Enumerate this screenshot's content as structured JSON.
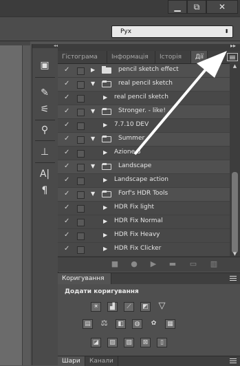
{
  "window": {
    "minimize": "▁",
    "restore": "⧉",
    "close": "✕"
  },
  "workspace": {
    "selected": "Рух"
  },
  "tabs": [
    {
      "label": "Гістограма"
    },
    {
      "label": "Інформація"
    },
    {
      "label": "Історія"
    },
    {
      "label": "Дії"
    }
  ],
  "actions": [
    {
      "label": "pencil sketch effect",
      "type": "set",
      "expanded": false
    },
    {
      "label": "real pencil sketch",
      "type": "set",
      "expanded": true
    },
    {
      "label": "real pencil sketch",
      "type": "action"
    },
    {
      "label": "Stronger. - like!",
      "type": "set",
      "expanded": true
    },
    {
      "label": "7.7.10 DEV",
      "type": "action"
    },
    {
      "label": "Summer",
      "type": "set",
      "expanded": true
    },
    {
      "label": "Azione 3",
      "type": "action"
    },
    {
      "label": "Landscape",
      "type": "set",
      "expanded": true
    },
    {
      "label": "Landscape action",
      "type": "action"
    },
    {
      "label": "Forf's HDR Tools",
      "type": "set",
      "expanded": true
    },
    {
      "label": "HDR Fix light",
      "type": "action"
    },
    {
      "label": "HDR Fix Normal",
      "type": "action"
    },
    {
      "label": "HDR Fix Heavy",
      "type": "action"
    },
    {
      "label": "HDR Fix Clicker",
      "type": "action"
    }
  ],
  "adjustments": {
    "tab": "Коригування",
    "title": "Додати коригування"
  },
  "layers": {
    "tabs": [
      "Шари",
      "Канали"
    ]
  },
  "colors": {
    "arrow": "#ffffff",
    "panel": "#505050"
  }
}
